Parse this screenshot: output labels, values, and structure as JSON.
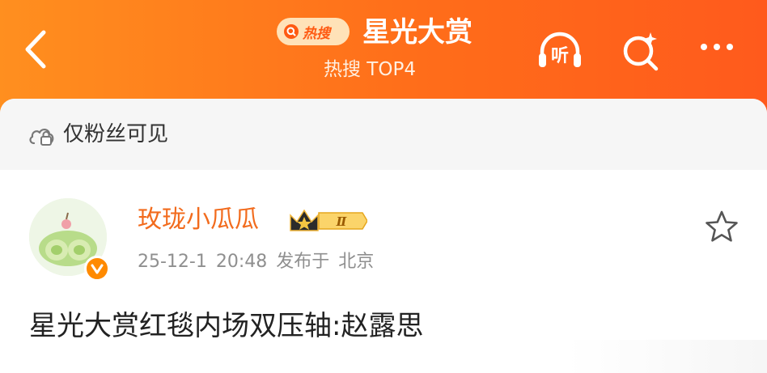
{
  "header": {
    "hot_badge_label": "热搜",
    "title": "星光大赏",
    "subtitle": "热搜 TOP4",
    "listen_label": "听",
    "icons": [
      "back-icon",
      "search-icon",
      "listen-icon",
      "sparkle-search-icon",
      "more-icon"
    ]
  },
  "visibility": {
    "text": "仅粉丝可见",
    "icon": "lock-cloud-icon"
  },
  "post": {
    "username": "玫珑小瓜瓜",
    "rank_badge": "Ⅱ",
    "date": "25-12-1",
    "time": "20:48",
    "published_text": "发布于",
    "location": "北京",
    "content": "星光大赏红毯内场双压轴:赵露思"
  },
  "colors": {
    "header_orange": "#ff6d1a",
    "username_orange": "#f26b1d",
    "meta_gray": "#8f8f8f",
    "verified_orange": "#ff8a00"
  }
}
